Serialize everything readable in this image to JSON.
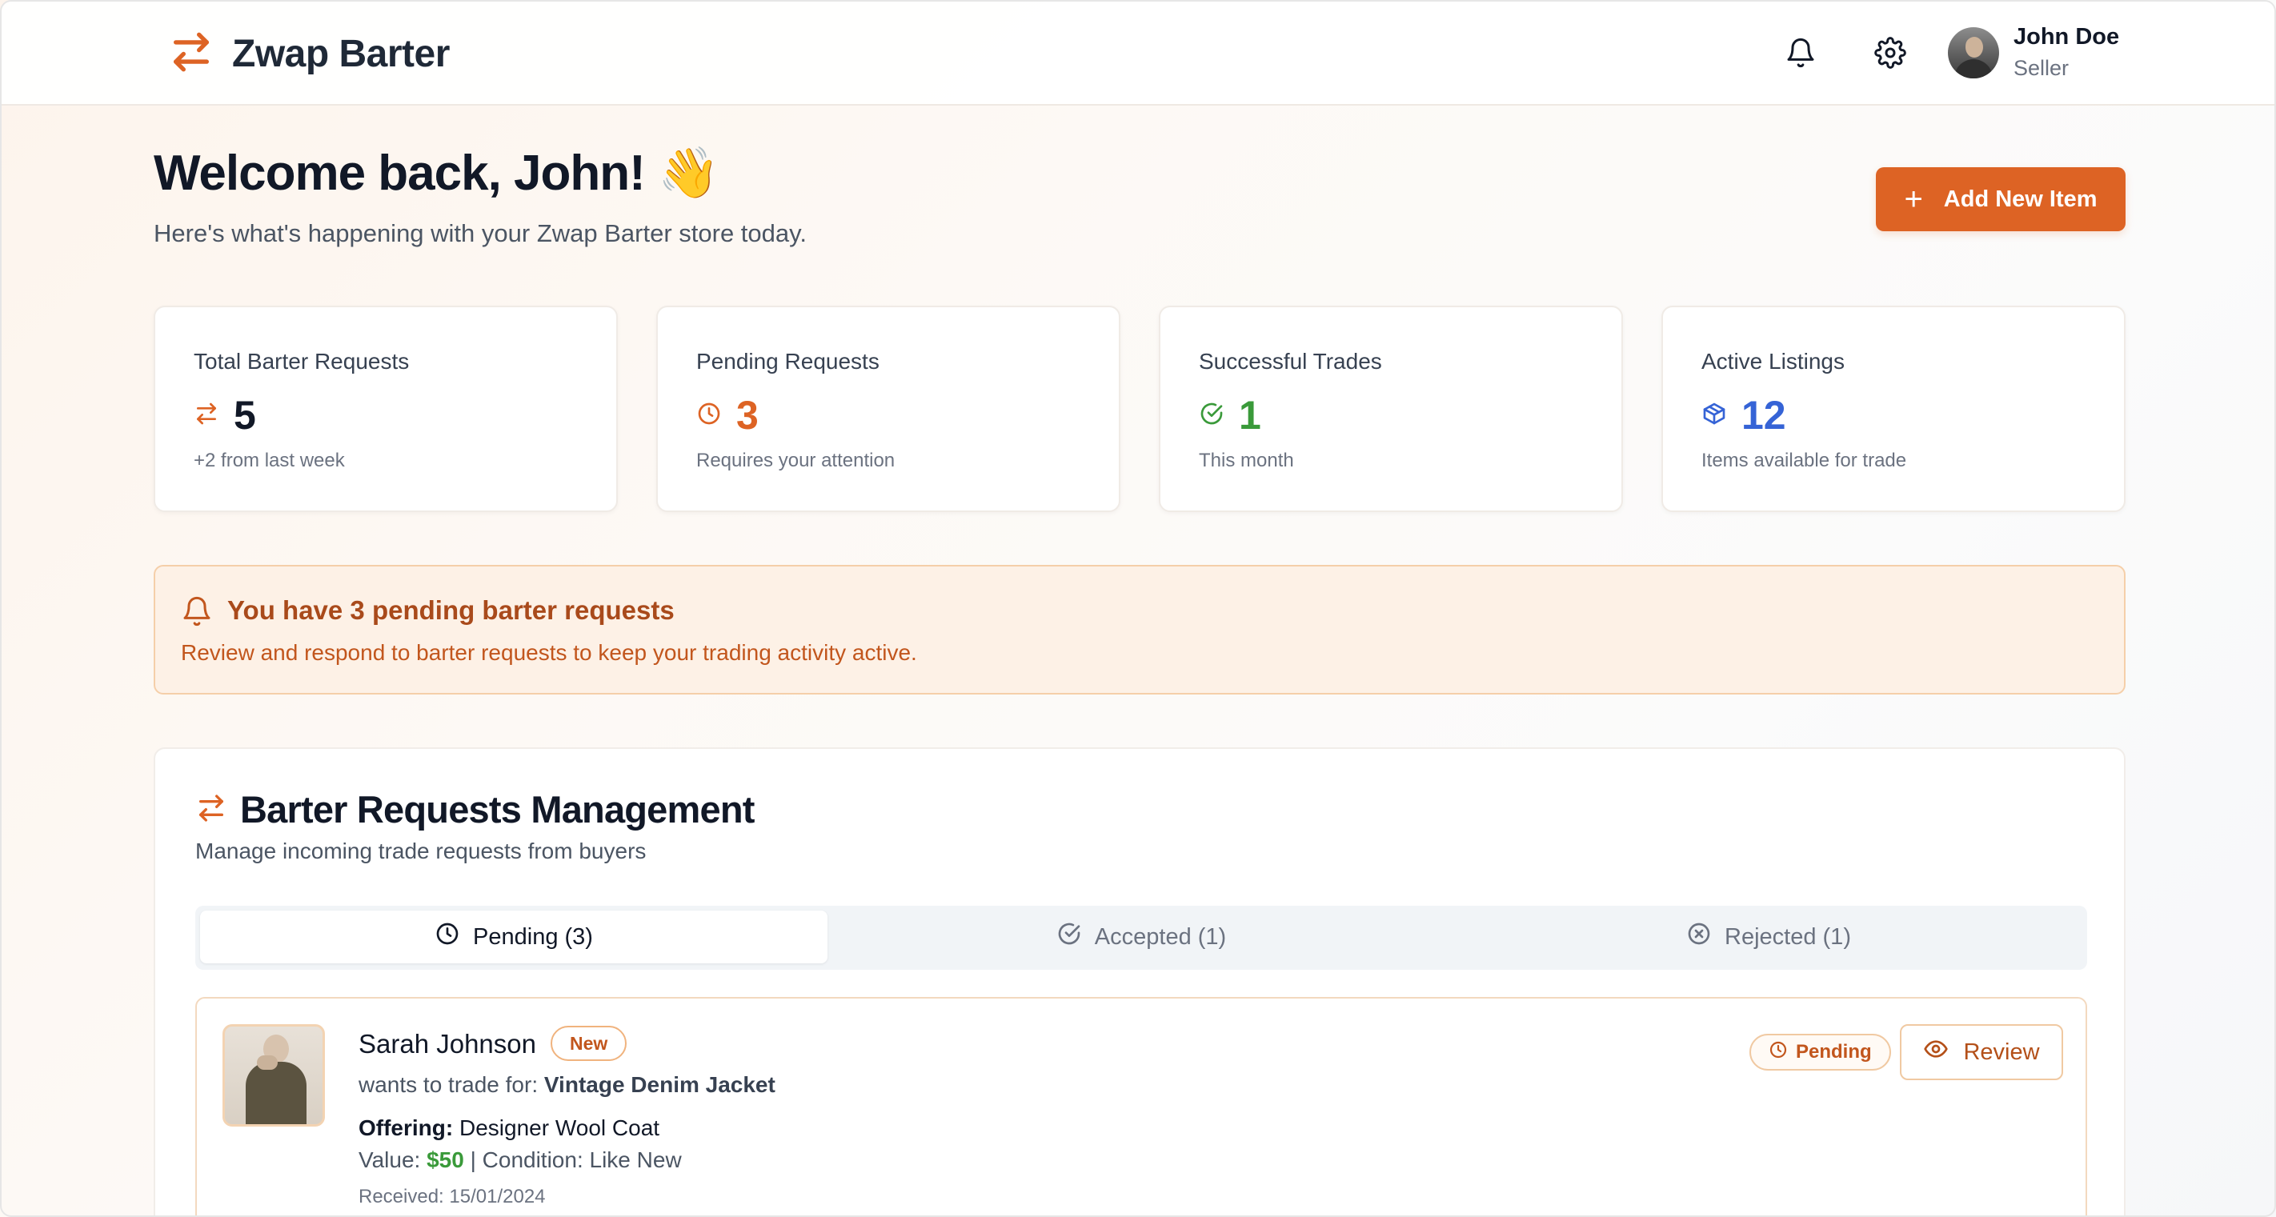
{
  "header": {
    "brand": "Zwap Barter",
    "user": {
      "name": "John Doe",
      "role": "Seller"
    }
  },
  "welcome": {
    "title": "Welcome back, John! 👋",
    "subtitle": "Here's what's happening with your Zwap Barter store today.",
    "add_button_label": "Add New Item"
  },
  "stats": [
    {
      "label": "Total Barter Requests",
      "value": "5",
      "note": "+2 from last week",
      "color": "#111827",
      "icon": "swap-icon"
    },
    {
      "label": "Pending Requests",
      "value": "3",
      "note": "Requires your attention",
      "color": "#dd6324",
      "icon": "clock-icon"
    },
    {
      "label": "Successful Trades",
      "value": "1",
      "note": "This month",
      "color": "#3a9a3a",
      "icon": "check-circle-icon"
    },
    {
      "label": "Active Listings",
      "value": "12",
      "note": "Items available for trade",
      "color": "#3563d6",
      "icon": "package-icon"
    }
  ],
  "alert": {
    "title": "You have 3 pending barter requests",
    "text": "Review and respond to barter requests to keep your trading activity active."
  },
  "management": {
    "title": "Barter Requests Management",
    "subtitle": "Manage incoming trade requests from buyers",
    "tabs": [
      {
        "label": "Pending (3)",
        "active": true
      },
      {
        "label": "Accepted (1)",
        "active": false
      },
      {
        "label": "Rejected (1)",
        "active": false
      }
    ],
    "request": {
      "name": "Sarah Johnson",
      "badge": "New",
      "wants_prefix": "wants to trade for: ",
      "wants_item": "Vintage Denim Jacket",
      "offering_label": "Offering:",
      "offering_item": " Designer Wool Coat",
      "value_label": "Value: ",
      "value": "$50",
      "condition": " | Condition: Like New",
      "received": "Received: 15/01/2024",
      "status": "Pending",
      "review_label": "Review"
    }
  },
  "colors": {
    "accent": "#dd6324",
    "success": "#3a9a3a",
    "info": "#3563d6"
  }
}
